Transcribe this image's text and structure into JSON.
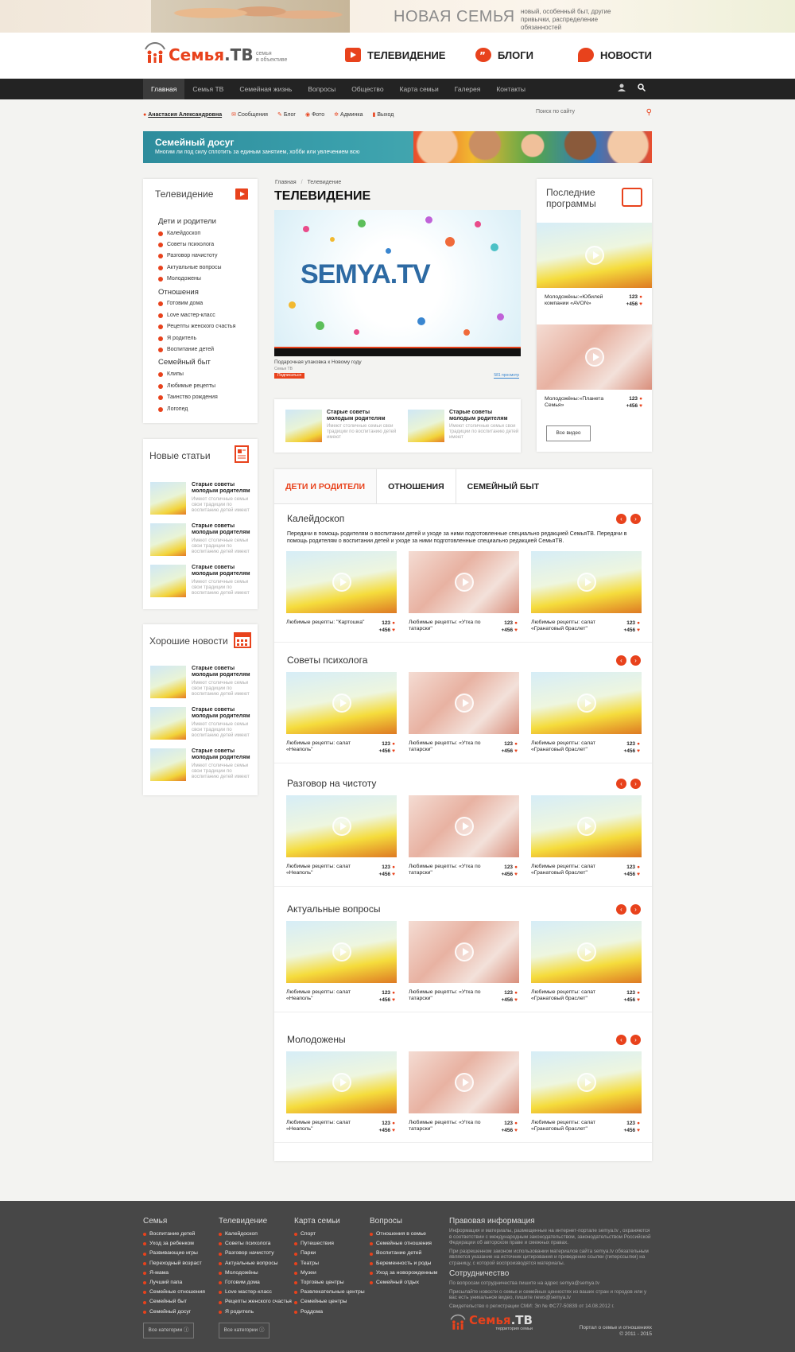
{
  "top_banner": {
    "title": "НОВАЯ СЕМЬЯ",
    "subtitle": "новый, особенный быт, другие привычки, распределение обязанностей"
  },
  "brand": {
    "logo": "Семья",
    "logo_suffix": ".ТВ",
    "tagline_1": "семья",
    "tagline_2": "в объективе",
    "accent": "#e8421c"
  },
  "header_nav": [
    {
      "label": "ТЕЛЕВИДЕНИЕ",
      "icon": "play-icon"
    },
    {
      "label": "БЛОГИ",
      "icon": "quote-icon"
    },
    {
      "label": "НОВОСТИ",
      "icon": "pin-icon"
    }
  ],
  "navbar": {
    "items": [
      "Главная",
      "Семья ТВ",
      "Семейная жизнь",
      "Вопросы",
      "Общество",
      "Карта семьи",
      "Галерея",
      "Контакты"
    ],
    "active": "Главная"
  },
  "userbar": {
    "user": "Анастасия Александровна",
    "links": [
      "Сообщения",
      "Блог",
      "Фото",
      "Админка",
      "Выход"
    ],
    "search_placeholder": "Поиск по сайту"
  },
  "promo": {
    "title": "Семейный досуг",
    "text": "Многим ли под силу сплотить за единым занятием, хобби или увлечением всю"
  },
  "sidebar_tv": {
    "title": "Телевидение",
    "groups": [
      {
        "name": "Дети и родители",
        "items": [
          "Калейдоскоп",
          "Советы психолога",
          "Разговор начистоту",
          "Актуальные вопросы",
          "Молодожены"
        ]
      },
      {
        "name": "Отношения",
        "items": [
          "Готовим дома",
          "Love мастер-класс",
          "Рецепты женского счастья",
          "Я родитель",
          "Воспитание детей"
        ]
      },
      {
        "name": "Семейный быт",
        "items": [
          "Клипы",
          "Любимые рецепты",
          "Таинство рождения",
          "Логопед"
        ]
      }
    ]
  },
  "article_text": {
    "title": "Старые советы молодым родителям",
    "desc": "Имеют столичные семьи свои традиции по воспитанию детей имеют"
  },
  "new_articles": {
    "title": "Новые статьи"
  },
  "good_news": {
    "title": "Хорошие новости"
  },
  "main": {
    "breadcrumb": [
      "Главная",
      "/",
      "Телевидение"
    ],
    "title": "ТЕЛЕВИДЕНИЕ",
    "video": {
      "logo": "SEMYA.TV",
      "caption": "Подарочная упаковка к Новому году",
      "views": "581 просмотр",
      "channel": "Семья ТВ",
      "subscribe": "Подписаться"
    }
  },
  "last_programs": {
    "title": "Последние программы",
    "items": [
      {
        "caption": "Молодожёны:«Юбилей компании «AVON»",
        "comments": "123",
        "likes": "+456"
      },
      {
        "caption": "Молодожёны:«Планета Семья»",
        "comments": "123",
        "likes": "+456"
      }
    ],
    "all_button": "Все видео"
  },
  "tabs": [
    "ДЕТИ И РОДИТЕЛИ",
    "ОТНОШЕНИЯ",
    "СЕМЕЙНЫЙ БЫТ"
  ],
  "sections": [
    {
      "title": "Калейдоскоп",
      "desc": "Передачи в помощь родителям о воспитании детей и уходе за ними подготовленные специально редакцией СемьяТВ. Передачи в помощь родителям о воспитании детей и уходе за ними подготовленные специально редакцией СемьяТВ.",
      "tiles": [
        {
          "cap": "Любимые рецепты: \"Картошка\""
        },
        {
          "cap": "Любимые рецепты: «Утка по татарски\""
        },
        {
          "cap": "Любимые рецепты: салат «Гранатовый браслет\""
        }
      ]
    },
    {
      "title": "Советы психолога",
      "desc": "",
      "tiles": [
        {
          "cap": "Любимые рецепты: салат «Неаполь\""
        },
        {
          "cap": "Любимые рецепты: «Утка по татарски\""
        },
        {
          "cap": "Любимые рецепты: салат «Гранатовый браслет\""
        }
      ]
    },
    {
      "title": "Разговор на чистоту",
      "desc": "",
      "tiles": [
        {
          "cap": "Любимые рецепты: салат «Неаполь\""
        },
        {
          "cap": "Любимые рецепты: «Утка по татарски\""
        },
        {
          "cap": "Любимые рецепты: салат «Гранатовый браслет\""
        }
      ]
    },
    {
      "title": "Актуальные вопросы",
      "desc": "",
      "tiles": [
        {
          "cap": "Любимые рецепты: салат «Неаполь\""
        },
        {
          "cap": "Любимые рецепты: «Утка по татарски\""
        },
        {
          "cap": "Любимые рецепты: салат «Гранатовый браслет\""
        }
      ]
    },
    {
      "title": "Молодожены",
      "desc": "",
      "tiles": [
        {
          "cap": "Любимые рецепты: салат «Неаполь\""
        },
        {
          "cap": "Любимые рецепты: «Утка по татарски\""
        },
        {
          "cap": "Любимые рецепты: салат «Гранатовый браслет\""
        }
      ]
    }
  ],
  "tile_counts": {
    "comments": "123",
    "likes": "+456"
  },
  "footer": {
    "cols": [
      {
        "title": "Семья",
        "items": [
          "Воспитание детей",
          "Уход за ребенком",
          "Развивающие игры",
          "Переходный возраст",
          "Я-мама",
          "Лучший папа",
          "Семейные отношения",
          "Семейный быт",
          "Семейный досуг"
        ],
        "btn": "Все категории"
      },
      {
        "title": "Телевидение",
        "items": [
          "Калейдоскоп",
          "Советы психолога",
          "Разговор начистоту",
          "Актуальные вопросы",
          "Молодожёны",
          "Готовим дома",
          "Love мастер-класс",
          "Рецепты женского счастья",
          "Я родитель"
        ],
        "btn": "Все категории"
      },
      {
        "title": "Карта семьи",
        "items": [
          "Спорт",
          "Путешествия",
          "Парки",
          "Театры",
          "Музеи",
          "Торговые центры",
          "Развлекательные центры",
          "Семейные центры",
          "Роддома"
        ]
      },
      {
        "title": "Вопросы",
        "items": [
          "Отношения в семье",
          "Семейные отношения",
          "Воспитание детей",
          "Беременность и роды",
          "Уход за новорожденным",
          "Семейный отдых"
        ]
      }
    ],
    "legal_title": "Правовая информация",
    "legal_1": "Информация и материалы, размещенные на интернет-портале semya.tv , охраняются в соответствии с международным законодательством, законодательством Российской Федерации об авторском праве и смежных правах.",
    "legal_2": "При разрешенном законом использовании материалов сайта semya.tv обязательным является указание на источник цитирования и приведение ссылки (гиперссылки) на страницу, с которой воспроизводятся материалы.",
    "coop_title": "Сотрудничество",
    "coop_1": "По вопросам сотрудничества пишите на адрес semya@semya.tv",
    "coop_2": "Присылайте новости о семье и семейных ценностях из ваших стран и городов или у вас есть уникальное видео, пишите news@semya.tv",
    "coop_3": "Свидетельство о регистрации СМИ: Эл № ФС77-50839 от 14.08.2012 г.",
    "logo": "Семья",
    "logo_suffix": ".ТВ",
    "logo_tag": "территория семьи",
    "copyright_1": "Портал о семье и отношениях",
    "copyright_2": "© 2011 - 2015"
  }
}
